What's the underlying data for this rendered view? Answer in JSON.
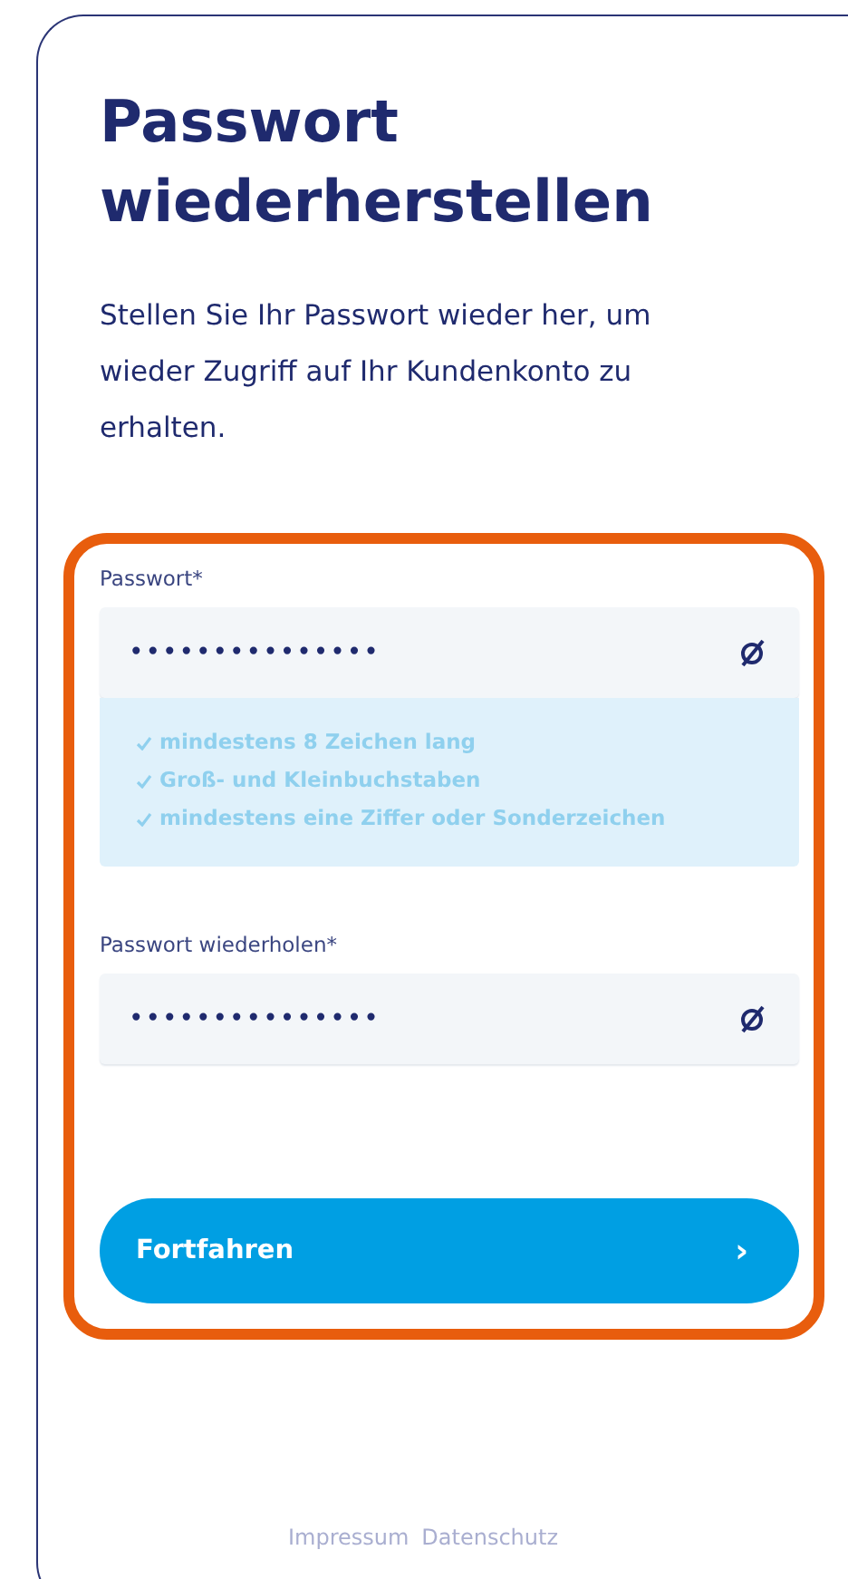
{
  "title": "Passwort wiederherstellen",
  "description": "Stellen Sie Ihr Passwort wieder her, um wieder Zugriff auf Ihr Kundenkonto zu erhalten.",
  "fields": [
    {
      "label": "Passwort*",
      "value": "•••••••••••••••",
      "hints": [
        "mindestens 8 Zeichen lang",
        "Groß- und Kleinbuchstaben",
        "mindestens eine Ziffer oder Sonderzeichen"
      ]
    },
    {
      "label": "Passwort wiederholen*",
      "value": "•••••••••••••••"
    }
  ],
  "button": {
    "label": "Fortfahren",
    "arrow": "›"
  },
  "footer_links": [
    "Impressum",
    "Datenschutz"
  ]
}
